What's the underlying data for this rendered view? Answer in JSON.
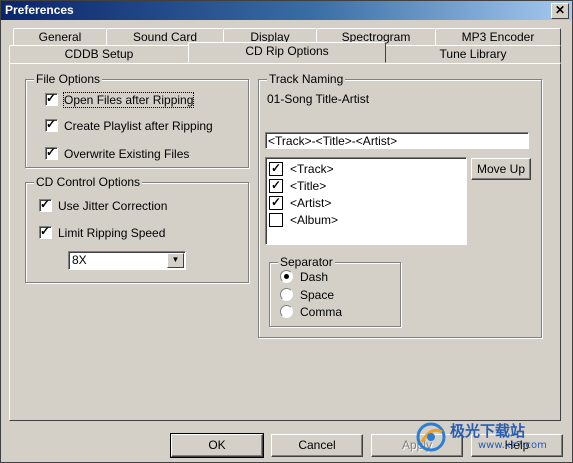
{
  "window": {
    "title": "Preferences",
    "close_label": "✕"
  },
  "tabs_back": [
    {
      "label": "General"
    },
    {
      "label": "Sound Card"
    },
    {
      "label": "Display"
    },
    {
      "label": "Spectrogram"
    },
    {
      "label": "MP3 Encoder"
    }
  ],
  "tabs_front": [
    {
      "label": "CDDB Setup"
    },
    {
      "label": "CD Rip Options"
    },
    {
      "label": "Tune Library"
    }
  ],
  "active_tab": "CD Rip Options",
  "file_options": {
    "legend": "File Options",
    "items": [
      {
        "label": "Open Files after Ripping",
        "checked": true
      },
      {
        "label": "Create Playlist after Ripping",
        "checked": true
      },
      {
        "label": "Overwrite Existing Files",
        "checked": true
      }
    ]
  },
  "cd_control": {
    "legend": "CD Control Options",
    "items": [
      {
        "label": "Use Jitter Correction",
        "checked": true
      },
      {
        "label": "Limit Ripping Speed",
        "checked": true
      }
    ],
    "speed_value": "8X"
  },
  "track_naming": {
    "legend": "Track Naming",
    "preview": "01-Song Title-Artist",
    "format": "<Track>-<Title>-<Artist>",
    "fields": [
      {
        "label": "<Track>",
        "checked": true
      },
      {
        "label": "<Title>",
        "checked": true
      },
      {
        "label": "<Artist>",
        "checked": true
      },
      {
        "label": "<Album>",
        "checked": false
      }
    ],
    "move_up_label": "Move Up"
  },
  "separator": {
    "legend": "Separator",
    "options": [
      {
        "label": "Dash",
        "selected": true
      },
      {
        "label": "Space",
        "selected": false
      },
      {
        "label": "Comma",
        "selected": false
      }
    ]
  },
  "buttons": {
    "ok": "OK",
    "cancel": "Cancel",
    "apply": "Apply",
    "help": "Help"
  },
  "watermark": {
    "text": "极光下载站",
    "url": "www.xz7.com"
  },
  "icons": {
    "check": "check-icon",
    "dropdown": "chevron-down-icon",
    "close": "close-icon"
  }
}
